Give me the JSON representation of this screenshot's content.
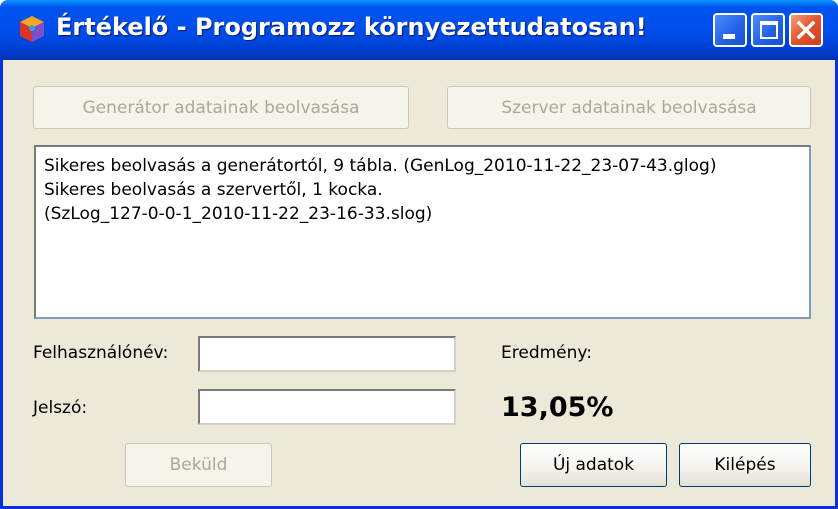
{
  "window": {
    "title": "Értékelő - Programozz környezettudatosan!",
    "app_icon": "colorful-cube-icon",
    "controls": [
      "minimize-icon",
      "maximize-icon",
      "close-icon"
    ]
  },
  "toolbar": {
    "read_generator_label": "Generátor adatainak beolvasása",
    "read_server_label": "Szerver adatainak beolvasása"
  },
  "log": {
    "lines": [
      "Sikeres beolvasás a generátortól, 9 tábla. (GenLog_2010-11-22_23-07-43.glog)",
      "Sikeres beolvasás a szervertől, 1 kocka.",
      "(SzLog_127-0-0-1_2010-11-22_23-16-33.slog)"
    ]
  },
  "form": {
    "username_label": "Felhasználónév:",
    "username_value": "",
    "password_label": "Jelszó:",
    "password_value": "",
    "result_label": "Eredmény:",
    "result_value": "13,05%"
  },
  "actions": {
    "submit_label": "Beküld",
    "new_data_label": "Új adatok",
    "exit_label": "Kilépés"
  },
  "colors": {
    "titlebar": "#0053ee",
    "window_body": "#ece9d8",
    "close_button": "#e2542f"
  }
}
